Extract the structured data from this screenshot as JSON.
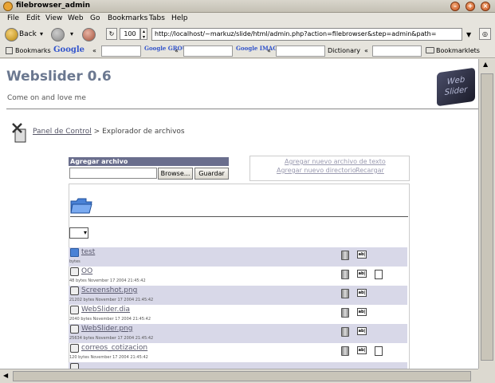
{
  "window": {
    "title": "filebrowser_admin"
  },
  "menu": [
    "File",
    "Edit",
    "View",
    "Web",
    "Go",
    "Bookmarks",
    "Tabs",
    "Help"
  ],
  "nav": {
    "back": "Back",
    "zoom": "100",
    "url": "http://localhost/~markuz/slide/html/admin.php?action=filebrowser&step=admin&path="
  },
  "bookmarks": {
    "bookmarks": "Bookmarks",
    "google": "Google",
    "groups": "Google GROUPS",
    "images": "Google IMAGES",
    "dictionary": "Dictionary",
    "bookmarklets": "Bookmarklets"
  },
  "site": {
    "title": "Webslider 0.6",
    "subtitle": "Come on and love me",
    "logo_text": "Web Slider"
  },
  "breadcrumb": {
    "link": "Panel de Control",
    "current": "> Explorador de archivos"
  },
  "upload": {
    "heading": "Agregar archivo",
    "browse": "Browse...",
    "submit": "Guardar"
  },
  "actions": {
    "new_text": "Agregar nuevo archivo de texto",
    "new_dir": "Agregar nuevo directorio",
    "reload": "Recargar"
  },
  "files": [
    {
      "name": "test",
      "meta": "bytes",
      "type": "folder",
      "editable": false
    },
    {
      "name": "OO",
      "meta": "48 bytes November 17 2004 21:45:42",
      "type": "text",
      "editable": true
    },
    {
      "name": "Screenshot.png",
      "meta": "21202 bytes November 17 2004 21:45:42",
      "type": "image",
      "editable": false
    },
    {
      "name": "WebSlider.dia",
      "meta": "2040 bytes November 17 2004 21:45:42",
      "type": "text",
      "editable": false
    },
    {
      "name": "WebSlider.png",
      "meta": "25634 bytes November 17 2004 21:45:42",
      "type": "image",
      "editable": false
    },
    {
      "name": "correos_cotizacion",
      "meta": "120 bytes November 17 2004 21:45:42",
      "type": "text",
      "editable": true
    }
  ],
  "row_icons": {
    "delete": "trash-icon",
    "rename": "rename-icon",
    "edit": "edit-icon"
  },
  "rename_label": "ab|",
  "colors": {
    "title": "#6b7890",
    "header_bar": "#6a6e8d",
    "row_shade": "#d8d8e8"
  }
}
